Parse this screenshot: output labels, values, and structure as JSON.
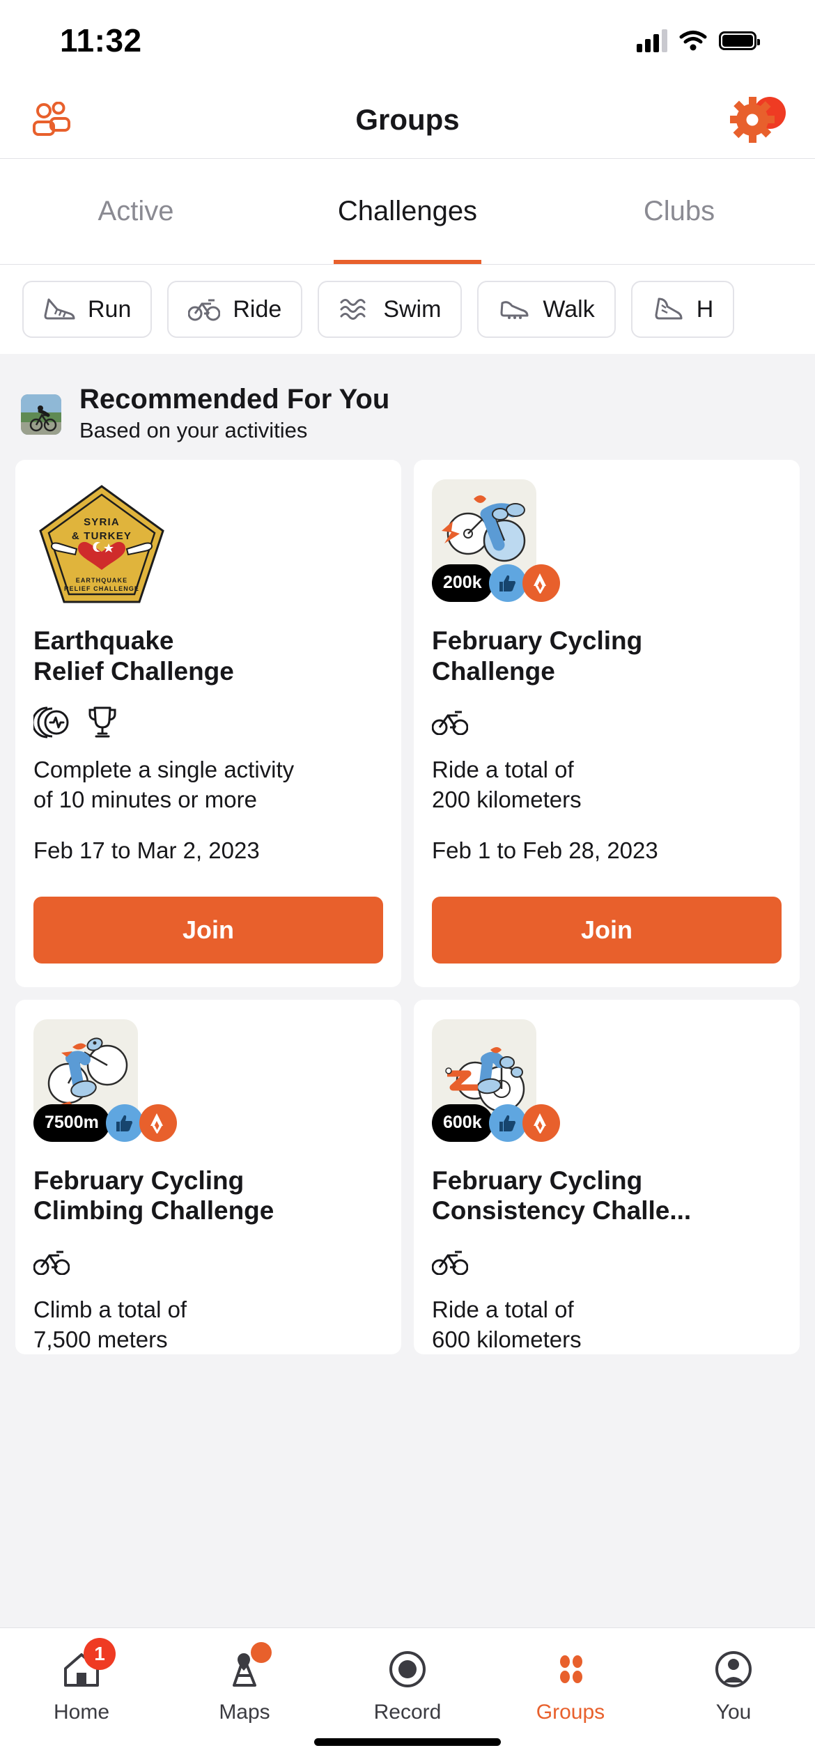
{
  "status_bar": {
    "time": "11:32",
    "signal_icon": "cellular-signal-icon",
    "wifi_icon": "wifi-icon",
    "battery_icon": "battery-icon"
  },
  "header": {
    "title": "Groups",
    "left_icon": "group-members-icon",
    "right_icon": "settings-gear-icon",
    "right_badge_color": "#ef3b23",
    "accent_color": "#e8602c"
  },
  "tabs": [
    {
      "label": "Active",
      "active": false
    },
    {
      "label": "Challenges",
      "active": true
    },
    {
      "label": "Clubs",
      "active": false
    }
  ],
  "sport_filters": [
    {
      "label": "Run",
      "icon": "running-shoe-icon"
    },
    {
      "label": "Ride",
      "icon": "bicycle-icon"
    },
    {
      "label": "Swim",
      "icon": "water-waves-icon"
    },
    {
      "label": "Walk",
      "icon": "walking-shoe-icon"
    },
    {
      "label": "H",
      "icon": "hiking-boot-icon"
    }
  ],
  "recommended": {
    "title": "Recommended For You",
    "subtitle": "Based on your activities",
    "avatar_icon": "cyclist-photo-avatar"
  },
  "challenge_cards": [
    {
      "media_type": "badge",
      "badge": {
        "top_text_line1": "SYRIA",
        "top_text_line2": "& TURKEY",
        "bottom_text_line1": "EARTHQUAKE",
        "bottom_text_line2": "RELIEF CHALLENGE",
        "fill_color": "#e0b43c",
        "heart_color": "#d12f2f"
      },
      "title": "Earthquake\nRelief Challenge",
      "sport_icons": [
        "all-sports-icon",
        "trophy-icon"
      ],
      "description": "Complete a single activity\nof 10 minutes or more",
      "dates": "Feb 17 to Mar 2, 2023",
      "button_label": "Join"
    },
    {
      "media_type": "thumbnail",
      "thumbnail": {
        "goal_pill": "200k",
        "like_badge": "thumbs-up-icon",
        "brand_badge": "strava-logo-icon",
        "illustration": "cyclist-illustration"
      },
      "title": "February Cycling\nChallenge",
      "sport_icons": [
        "bicycle-icon"
      ],
      "description": "Ride a total of\n200 kilometers",
      "dates": "Feb 1 to Feb 28, 2023",
      "button_label": "Join"
    },
    {
      "media_type": "thumbnail",
      "thumbnail": {
        "goal_pill": "7500m",
        "like_badge": "thumbs-up-icon",
        "brand_badge": "strava-logo-icon",
        "illustration": "climbing-cyclist-illustration"
      },
      "title": "February Cycling\nClimbing Challenge",
      "sport_icons": [
        "bicycle-icon"
      ],
      "description": "Climb a total of\n7,500 meters",
      "dates": "",
      "button_label": ""
    },
    {
      "media_type": "thumbnail",
      "thumbnail": {
        "goal_pill": "600k",
        "like_badge": "thumbs-up-icon",
        "brand_badge": "strava-logo-icon",
        "illustration": "zigzag-cyclist-illustration"
      },
      "title": "February Cycling\nConsistency Challe...",
      "sport_icons": [
        "bicycle-icon"
      ],
      "description": "Ride a total of\n600 kilometers",
      "dates": "",
      "button_label": ""
    }
  ],
  "bottom_nav": [
    {
      "label": "Home",
      "icon": "home-icon",
      "badge": "1",
      "active": false
    },
    {
      "label": "Maps",
      "icon": "map-route-icon",
      "dot": true,
      "active": false
    },
    {
      "label": "Record",
      "icon": "record-circle-icon",
      "active": false
    },
    {
      "label": "Groups",
      "icon": "groups-dots-icon",
      "active": true
    },
    {
      "label": "You",
      "icon": "profile-avatar-icon",
      "active": false
    }
  ]
}
